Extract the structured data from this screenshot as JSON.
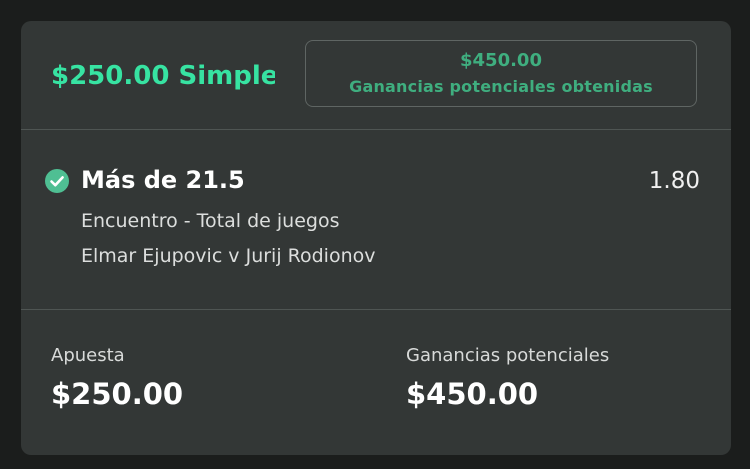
{
  "header": {
    "bet_title": "$250.00 Simple",
    "returns_amount": "$450.00",
    "returns_label": "Ganancias potenciales obtenidas"
  },
  "selection": {
    "icon": "check-circle-icon",
    "name": "Más de 21.5",
    "odds": "1.80",
    "market": "Encuentro - Total de juegos",
    "event": "Elmar Ejupovic v Jurij Rodionov"
  },
  "footer": {
    "stake_label": "Apuesta",
    "stake_value": "$250.00",
    "potential_label": "Ganancias potenciales",
    "potential_value": "$450.00"
  },
  "colors": {
    "accent": "#37e3a2",
    "accent_muted": "#3fae7f",
    "card_bg": "#333736",
    "page_bg": "#1b1d1c"
  }
}
